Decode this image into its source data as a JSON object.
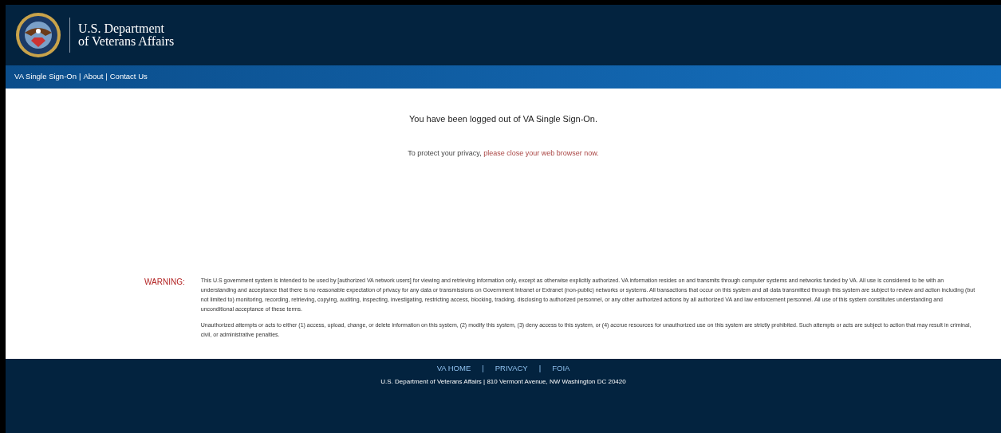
{
  "header": {
    "title_line_1": "U.S. Department",
    "title_line_2": "of Veterans Affairs"
  },
  "nav": {
    "links": [
      "VA Single Sign-On",
      "About",
      "Contact Us"
    ],
    "separator": "|"
  },
  "main": {
    "heading": "You have been logged out of VA Single Sign-On.",
    "notice_prefix": "To protect your privacy,",
    "notice_emphasis": "please close your web browser now."
  },
  "warning": {
    "label": "WARNING:",
    "paragraphs": [
      "This U.S government system is intended to be used by [authorized VA network users] for viewing and retrieving information only, except as otherwise explicitly authorized. VA information resides on and transmits through computer systems and networks funded by VA. All use is considered to be with an understanding and acceptance that there is no reasonable expectation of privacy for any data or transmissions on Government Intranet or Extranet (non-public) networks or systems. All transactions that occur on this system and all data transmitted through this system are subject to review and action including (but not limited to) monitoring, recording, retrieving, copying, auditing, inspecting, investigating, restricting access, blocking, tracking, disclosing to authorized personnel, or any other authorized actions by all authorized VA and law enforcement personnel. All use of this system constitutes understanding and unconditional acceptance of these terms.",
      "Unauthorized attempts or acts to either (1) access, upload, change, or delete information on this system, (2) modify this system, (3) deny access to this system, or (4) accrue resources for unauthorized use on this system are strictly prohibited. Such attempts or acts are subject to action that may result in criminal, civil, or administrative penalties."
    ]
  },
  "footer": {
    "links": [
      "VA HOME",
      "PRIVACY",
      "FOIA"
    ],
    "separator": "|",
    "address": "U.S. Department of Veterans Affairs | 810 Vermont Avenue, NW Washington DC 20420"
  }
}
